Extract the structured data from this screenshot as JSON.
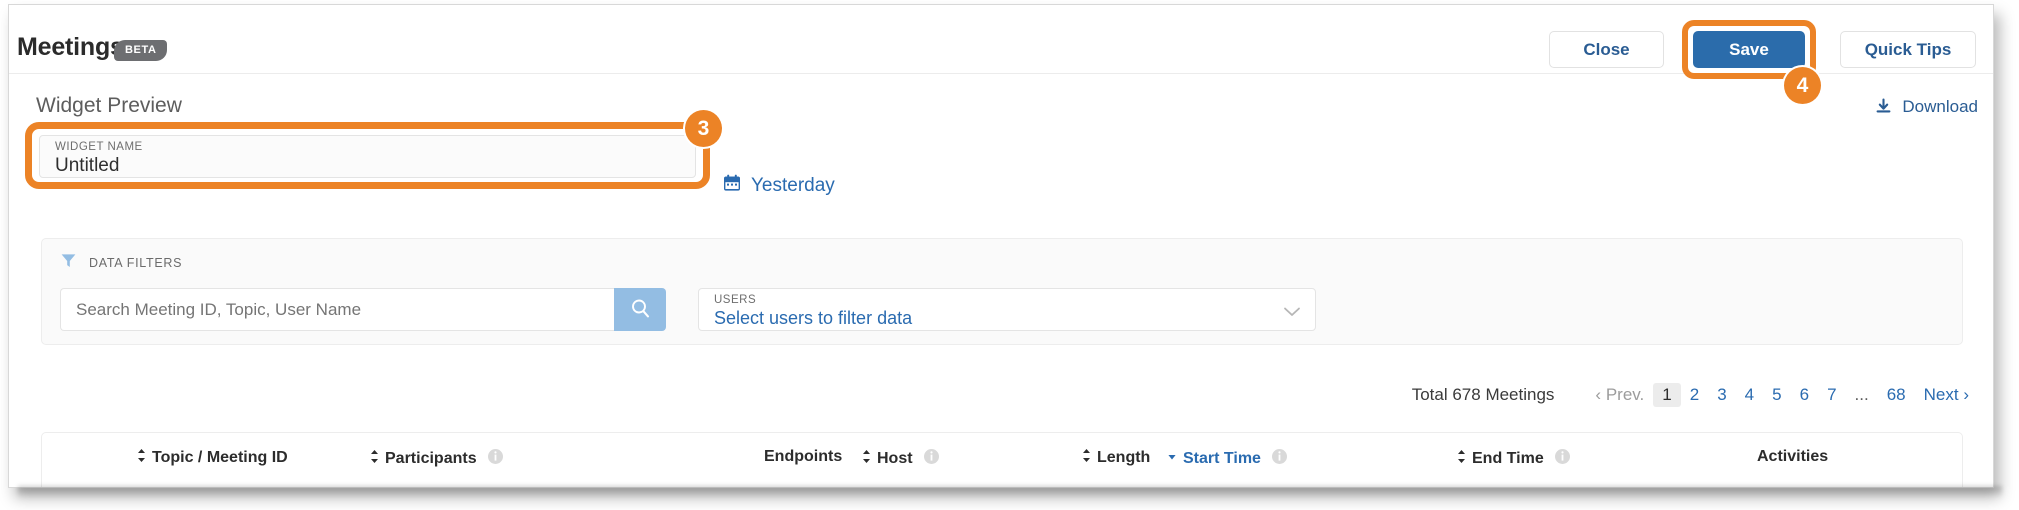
{
  "header": {
    "title": "Meetings",
    "badge": "BETA",
    "buttons": {
      "close": "Close",
      "save": "Save",
      "quick_tips": "Quick Tips"
    }
  },
  "annotations": [
    {
      "step": "3",
      "target": "widget-name-field"
    },
    {
      "step": "4",
      "target": "save-button"
    }
  ],
  "preview": {
    "section_label": "Widget Preview",
    "download_label": "Download",
    "download_icon": "download-icon"
  },
  "widget_name": {
    "label": "WIDGET NAME",
    "value": "Untitled",
    "placeholder": "Untitled"
  },
  "date_range": {
    "icon": "calendar-icon",
    "label": "Yesterday"
  },
  "filters": {
    "icon": "filter-funnel-icon",
    "label": "DATA FILTERS",
    "search": {
      "placeholder": "Search Meeting ID, Topic, User Name",
      "value": "",
      "button_icon": "search-icon"
    },
    "users": {
      "label": "USERS",
      "value": "Select users to filter data",
      "chevron_icon": "chevron-down-icon"
    }
  },
  "pagination": {
    "total_label": "Total 678 Meetings",
    "prev_label": "Prev.",
    "next_label": "Next",
    "pages": [
      "1",
      "2",
      "3",
      "4",
      "5",
      "6",
      "7",
      "...",
      "68"
    ],
    "active_page": "1"
  },
  "table": {
    "columns": [
      {
        "label": "Topic / Meeting ID",
        "sortable": true,
        "info": false,
        "sorted": false
      },
      {
        "label": "Participants",
        "sortable": true,
        "info": true,
        "sorted": false
      },
      {
        "label": "Endpoints",
        "sortable": false,
        "info": false,
        "sorted": false
      },
      {
        "label": "Host",
        "sortable": true,
        "info": true,
        "sorted": false
      },
      {
        "label": "Length",
        "sortable": true,
        "info": false,
        "sorted": false
      },
      {
        "label": "Start Time",
        "sortable": true,
        "info": true,
        "sorted": true
      },
      {
        "label": "End Time",
        "sortable": true,
        "info": true,
        "sorted": false
      },
      {
        "label": "Activities",
        "sortable": false,
        "info": false,
        "sorted": false
      }
    ]
  },
  "colors": {
    "accent_blue": "#2a6bb0",
    "save_blue": "#2b6cab",
    "annotation_orange": "#ec8326",
    "badge_gray": "#6d6e71",
    "search_button_blue": "#93bde3"
  }
}
